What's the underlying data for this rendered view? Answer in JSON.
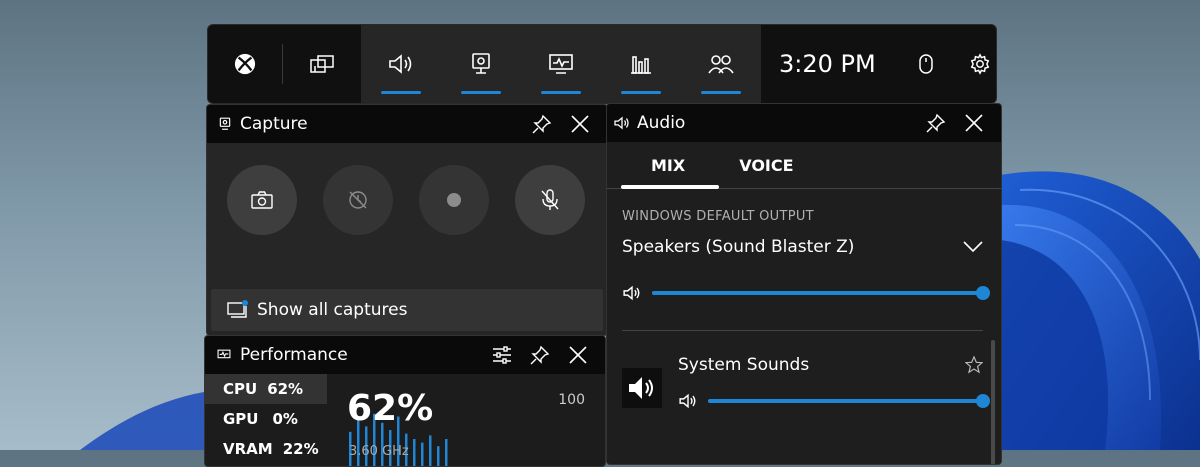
{
  "topbar": {
    "clock": "3:20 PM",
    "icons": [
      "xbox-icon",
      "widget-menu-icon",
      "audio-icon",
      "capture-icon",
      "performance-icon",
      "resources-icon",
      "social-icon",
      "mouse-icon",
      "gear-icon"
    ]
  },
  "capture": {
    "title": "Capture",
    "show_all": "Show all captures"
  },
  "audio": {
    "title": "Audio",
    "tabs": [
      {
        "label": "MIX"
      },
      {
        "label": "VOICE"
      }
    ],
    "section_label": "WINDOWS DEFAULT OUTPUT",
    "device": "Speakers (Sound Blaster Z)",
    "master_volume": 100,
    "apps": [
      {
        "name": "System Sounds",
        "volume": 100
      }
    ]
  },
  "performance": {
    "title": "Performance",
    "items": [
      {
        "label": "CPU",
        "value": "62%"
      },
      {
        "label": "GPU",
        "value": "0%"
      },
      {
        "label": "VRAM",
        "value": "22%"
      }
    ],
    "big_value": "62%",
    "max_label": "100",
    "frequency": "3.60 GHz",
    "graph_values": [
      38,
      52,
      44,
      58,
      48,
      40,
      55,
      36,
      30,
      26,
      34,
      22,
      30
    ]
  },
  "colors": {
    "accent": "#1f86d6",
    "panel": "#1c1c1c",
    "header": "#0a0a0a"
  }
}
